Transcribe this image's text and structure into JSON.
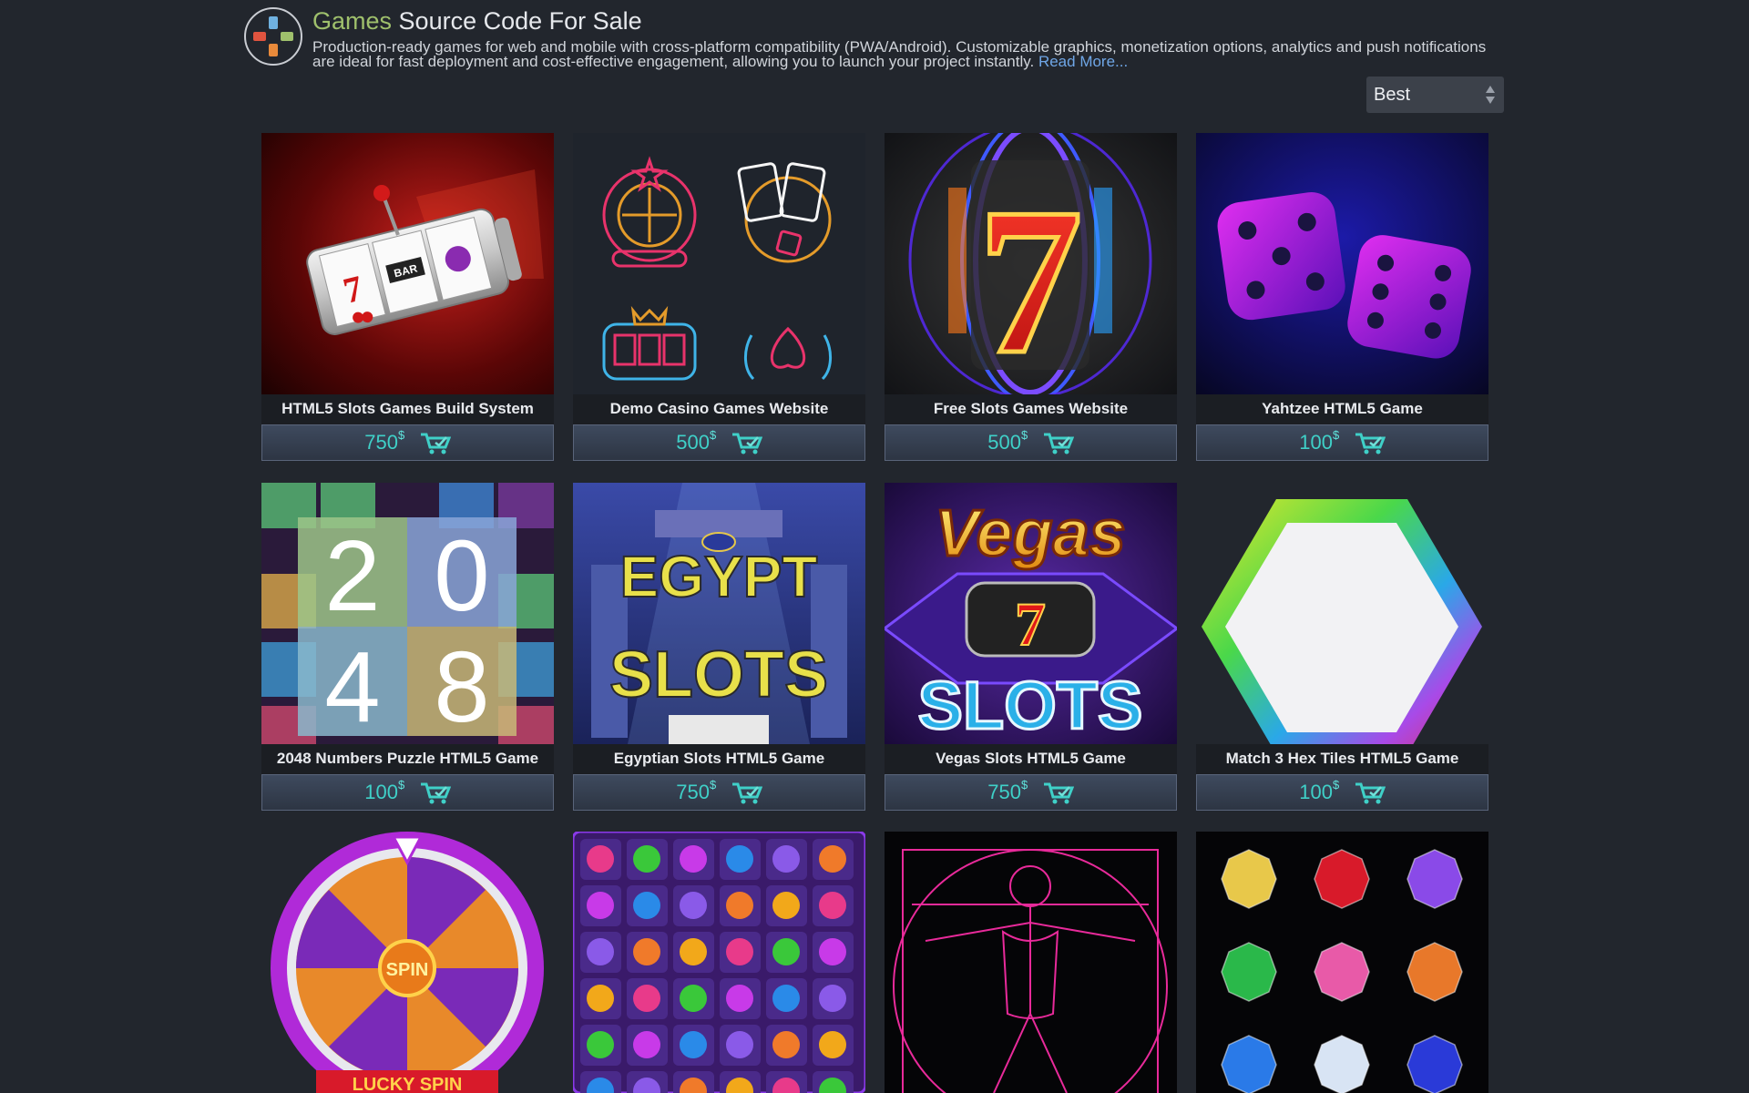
{
  "header": {
    "title_accent": "Games",
    "title_rest": "Source Code For Sale",
    "description": "Production-ready games for web and mobile with cross-platform compatibility (PWA/Android). Customizable graphics, monetization options, analytics and push notifications are ideal for fast deployment and cost-effective engagement, allowing you to launch your project instantly.",
    "read_more": "Read More..."
  },
  "sort": {
    "selected": "Best"
  },
  "currency": "$",
  "products": [
    {
      "title": "HTML5 Slots Games Build System",
      "price": "750"
    },
    {
      "title": "Demo Casino Games Website",
      "price": "500"
    },
    {
      "title": "Free Slots Games Website",
      "price": "500"
    },
    {
      "title": "Yahtzee HTML5 Game",
      "price": "100"
    },
    {
      "title": "2048 Numbers Puzzle HTML5 Game",
      "price": "100"
    },
    {
      "title": "Egyptian Slots HTML5 Game",
      "price": "750"
    },
    {
      "title": "Vegas Slots HTML5 Game",
      "price": "750"
    },
    {
      "title": "Match 3 Hex Tiles HTML5 Game",
      "price": "100"
    }
  ],
  "thumbnail_text": {
    "numbers_2048": [
      "2",
      "0",
      "4",
      "8"
    ],
    "egypt_line1": "EGYPT",
    "egypt_line2": "SLOTS",
    "vegas_line1": "Vegas",
    "vegas_line2": "SLOTS",
    "vegas_seven": "7",
    "seven": "7",
    "spin": "SPIN",
    "lucky_spin": "LUCKY SPIN"
  },
  "colors": {
    "background": "#22262d",
    "accent_title": "#9fc06c",
    "price": "#3fd0c8",
    "link": "#6fa6e6"
  }
}
